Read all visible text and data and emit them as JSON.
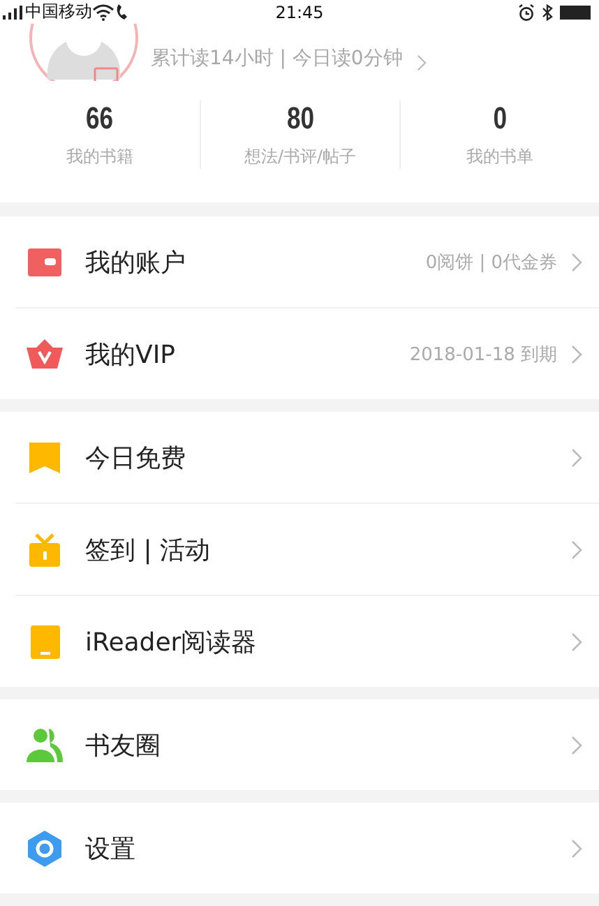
{
  "status_bar": {
    "carrier": "中国移动",
    "time": "21:45"
  },
  "profile": {
    "reading_summary": "累计读14小时 | 今日读0分钟"
  },
  "stats": [
    {
      "value": "66",
      "label": "我的书籍"
    },
    {
      "value": "80",
      "label": "想法/书评/帖子"
    },
    {
      "value": "0",
      "label": "我的书单"
    }
  ],
  "menu_groups": [
    {
      "items": [
        {
          "kind": "wallet",
          "label": "我的账户",
          "detail": "0阅饼 | 0代金券"
        },
        {
          "kind": "vip",
          "label": "我的VIP",
          "detail": "2018-01-18 到期"
        }
      ]
    },
    {
      "items": [
        {
          "kind": "bookmark",
          "label": "今日免费"
        },
        {
          "kind": "gift",
          "label": "签到 | 活动"
        },
        {
          "kind": "device",
          "label": "iReader阅读器"
        }
      ]
    },
    {
      "items": [
        {
          "kind": "friends",
          "label": "书友圈"
        }
      ]
    },
    {
      "items": [
        {
          "kind": "settings",
          "label": "设置"
        }
      ]
    }
  ]
}
